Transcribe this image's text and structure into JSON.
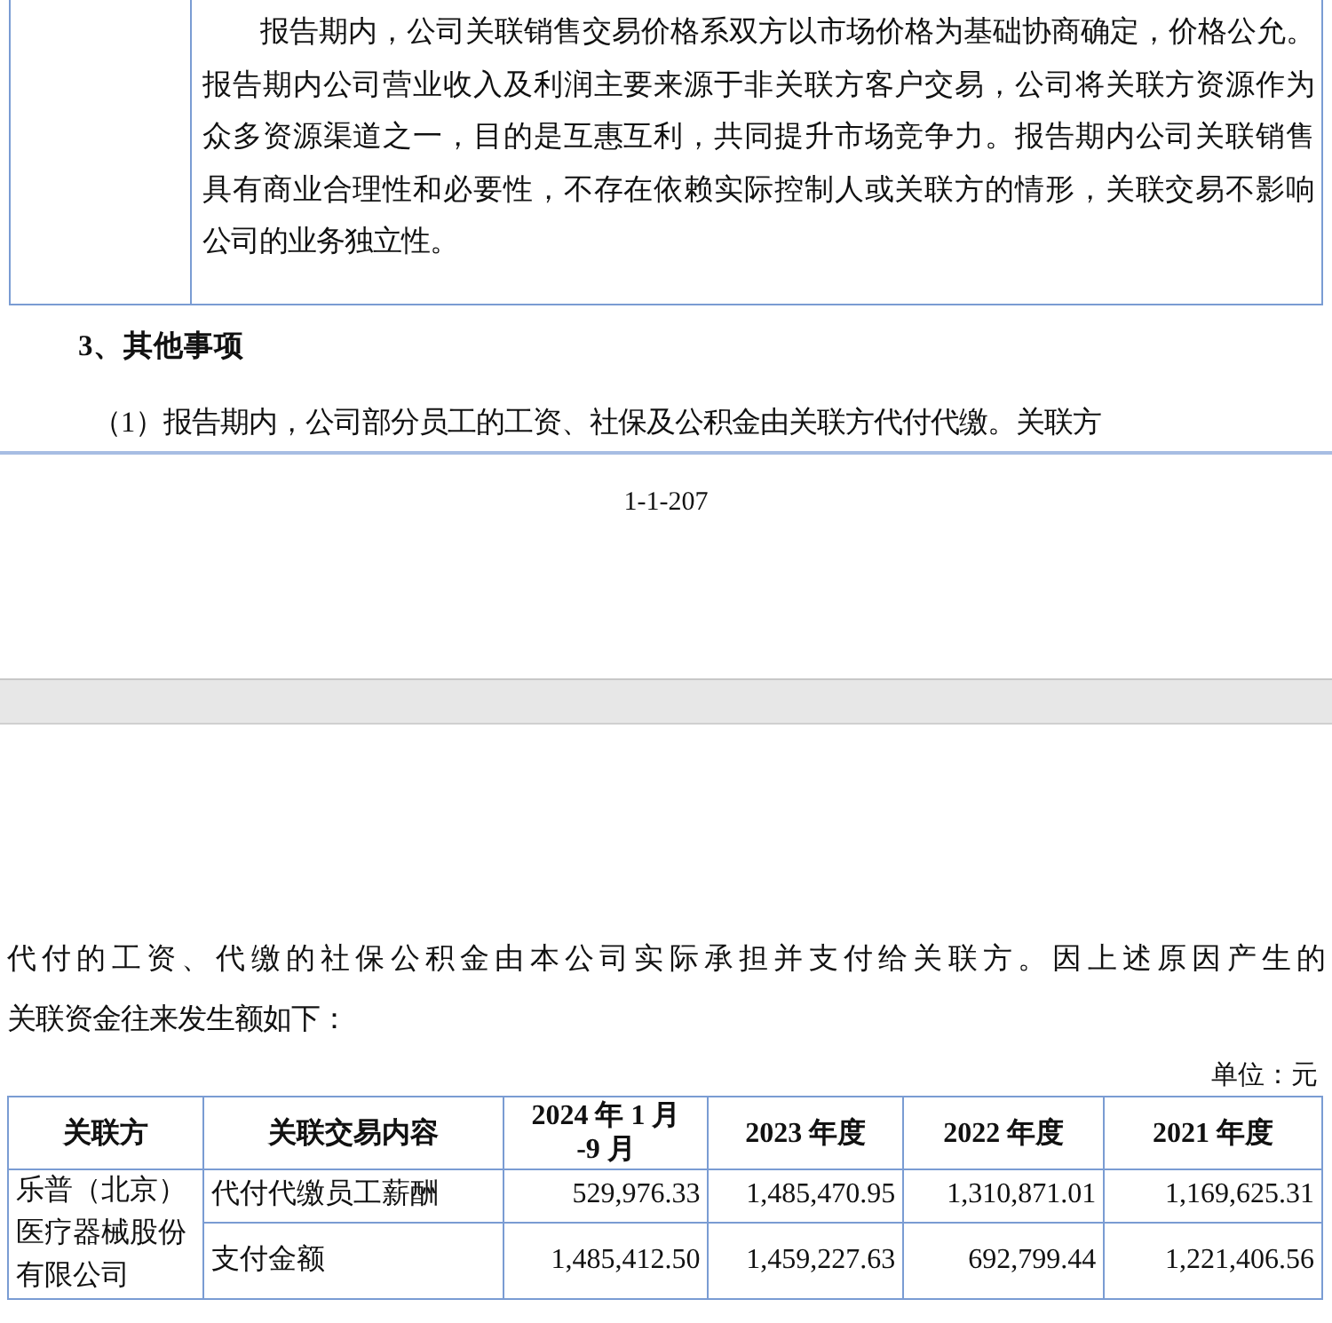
{
  "page_1": {
    "cell_lines": [
      "报告期内，公司关联销售交易价格系双方以市场价格为基础协商确定，价格公允。",
      "报告期内公司营业收入及利润主要来源于非关联方客户交易，公司将关联方资源作为",
      "众多资源渠道之一，目的是互惠互利，共同提升市场竞争力。报告期内公司关联销售",
      "具有商业合理性和必要性，不存在依赖实际控制人或关联方的情形，关联交易不影响",
      "公司的业务独立性。"
    ],
    "heading": "3、其他事项",
    "paragraph": "（1）报告期内，公司部分员工的工资、社保及公积金由关联方代付代缴。关联方",
    "page_number": "1-1-207"
  },
  "page_2": {
    "paragraph_lines": [
      "代付的工资、代缴的社保公积金由本公司实际承担并支付给关联方。因上述原因产生的",
      "关联资金往来发生额如下："
    ],
    "unit": "单位：元",
    "table": {
      "columns": [
        "关联方",
        "关联交易内容",
        "2024 年 1 月 -9 月",
        "2023 年度",
        "2022 年度",
        "2021 年度"
      ],
      "party": "乐普（北京）医疗器械股份有限公司",
      "rows": [
        {
          "content": "代付代缴员工薪酬",
          "values": [
            "529,976.33",
            "1,485,470.95",
            "1,310,871.01",
            "1,169,625.31"
          ]
        },
        {
          "content": "支付金额",
          "values": [
            "1,485,412.50",
            "1,459,227.63",
            "692,799.44",
            "1,221,406.56"
          ]
        }
      ]
    }
  }
}
